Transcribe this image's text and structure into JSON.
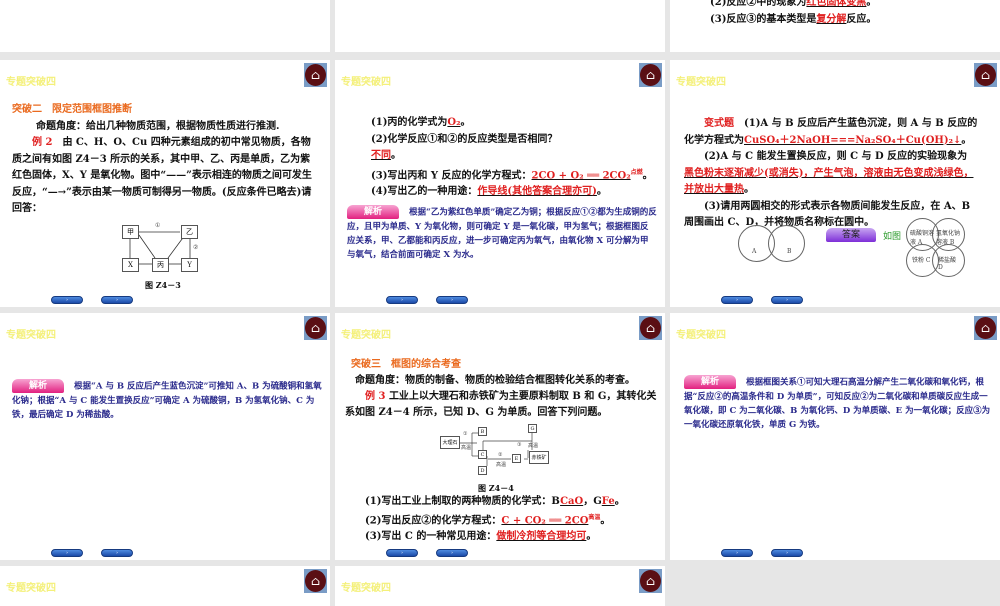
{
  "common": {
    "header": "专题突破四",
    "home_icon": "home-icon",
    "nav_buttons": [
      "›",
      "›"
    ]
  },
  "s0": {
    "l2": "(2)反应②中的现象为",
    "a2": "红色固体变黑",
    "l3": "(3)反应③的基本类型是",
    "a3": "复分解",
    "l3e": "反应。"
  },
  "s1": {
    "title": "突破二　限定范围框图推断",
    "angle": "命题角度：给出几种物质范围，根据物质性质进行推测.",
    "ex": "例 2",
    "q": "由 C、H、O、Cu 四种元素组成的初中常见物质，各物质之间有如图 Z4－3 所示的关系，其中甲、乙、丙是单质，乙为紫红色固体，X、Y 是氧化物。图中“——”表示相连的物质之间可发生反应，“—→”表示由某一物质可制得另一物质。(反应条件已略去)请回答：",
    "nodes": [
      "甲",
      "乙",
      "X",
      "丙",
      "Y"
    ],
    "marks": [
      "①",
      "②"
    ],
    "caption": "图 Z4－3"
  },
  "s2": {
    "q1": "(1)丙的化学式为",
    "a1": "O₂",
    "q2": "(2)化学反应①和②的反应类型是否相同？",
    "a2": "不同",
    "q3": "(3)写出丙和 Y 反应的化学方程式：",
    "a3": "2CO + O₂ ══ 2CO₂",
    "cond": "点燃",
    "q4": "(4)写出乙的一种用途：",
    "a4": "作导线(其他答案合理亦可)",
    "jx": "解析",
    "exp": "根据“乙为紫红色单质”确定乙为铜；根据反应①②都为生成铜的反应，且甲为单质、Y 为氧化物，则可确定 Y 是一氧化碳，甲为氢气；根据框图反应关系，甲、乙都能和丙反应，进一步可确定丙为氧气，由氧化物 X 可分解为甲与氧气，结合前面可确定 X 为水。"
  },
  "s3": {
    "label": "变式题",
    "q1": "(1)A 与 B 反应后产生蓝色沉淀，则 A 与 B 反应的化学方程式为",
    "a1": "CuSO₄＋2NaOH===Na₂SO₄＋Cu(OH)₂↓",
    "q2": "(2)A 与 C 能发生置换反应，则 C 与 D 反应的实验现象为",
    "a2": "黑色粉末逐渐减少(或消失)，产生气泡，溶液由无色变成浅绿色，并放出大量热",
    "q3": "(3)请用两圆相交的形式表示各物质间能发生反应，在 A、B 周围画出 C、D，并将物质名称标在圆中。",
    "circA": "A",
    "circB": "B",
    "da": "答案",
    "see": "如图",
    "c": [
      "硫酸铜溶液 A",
      "氢氧化钠溶液 B",
      "铁粉 C",
      "稀盐酸 D"
    ]
  },
  "s4": {
    "jx": "解析",
    "exp": "根据“A 与 B 反应后产生蓝色沉淀”可推知 A、B 为硫酸铜和氢氧化钠；根据“A 与 C 能发生置换反应”可确定 A 为硫酸铜，B 为氢氧化钠、C 为铁，最后确定 D 为稀盐酸。"
  },
  "s5": {
    "title": "突破三　框图的综合考查",
    "angle": "命题角度：物质的制备、物质的检验结合框图转化关系的考查。",
    "ex": "例 3",
    "q": "工业上以大理石和赤铁矿为主要原料制取 B 和 G，其转化关系如图 Z4－4 所示，已知 D、G 为单质。回答下列问题。",
    "nodes": [
      "大理石",
      "B",
      "C",
      "D",
      "E",
      "G",
      "赤铁矿"
    ],
    "marks": [
      "①",
      "高温",
      "②",
      "高温",
      "③",
      "高温"
    ],
    "caption": "图 Z4－4",
    "q1": "(1)写出工业上制取的两种物质的化学式：B",
    "a1b": "CaO",
    "q1g": "，G",
    "a1g": "Fe",
    "q2": "(2)写出反应②的化学方程式：",
    "a2": "C + CO₂ ══ 2CO",
    "cond": "高温",
    "q3": "(3)写出 C 的一种常见用途：",
    "a3": "做制冷剂等合理均可"
  },
  "s6": {
    "jx": "解析",
    "exp": "根据框图关系①可知大理石高温分解产生二氧化碳和氧化钙，根据“反应②的高温条件和 D 为单质”，可知反应②为二氧化碳和单质碳反应生成一氧化碳，即 C 为二氧化碳、B 为氧化钙、D 为单质碳、E 为一氧化碳；反应③为一氧化碳还原氧化铁，单质 G 为铁。"
  }
}
